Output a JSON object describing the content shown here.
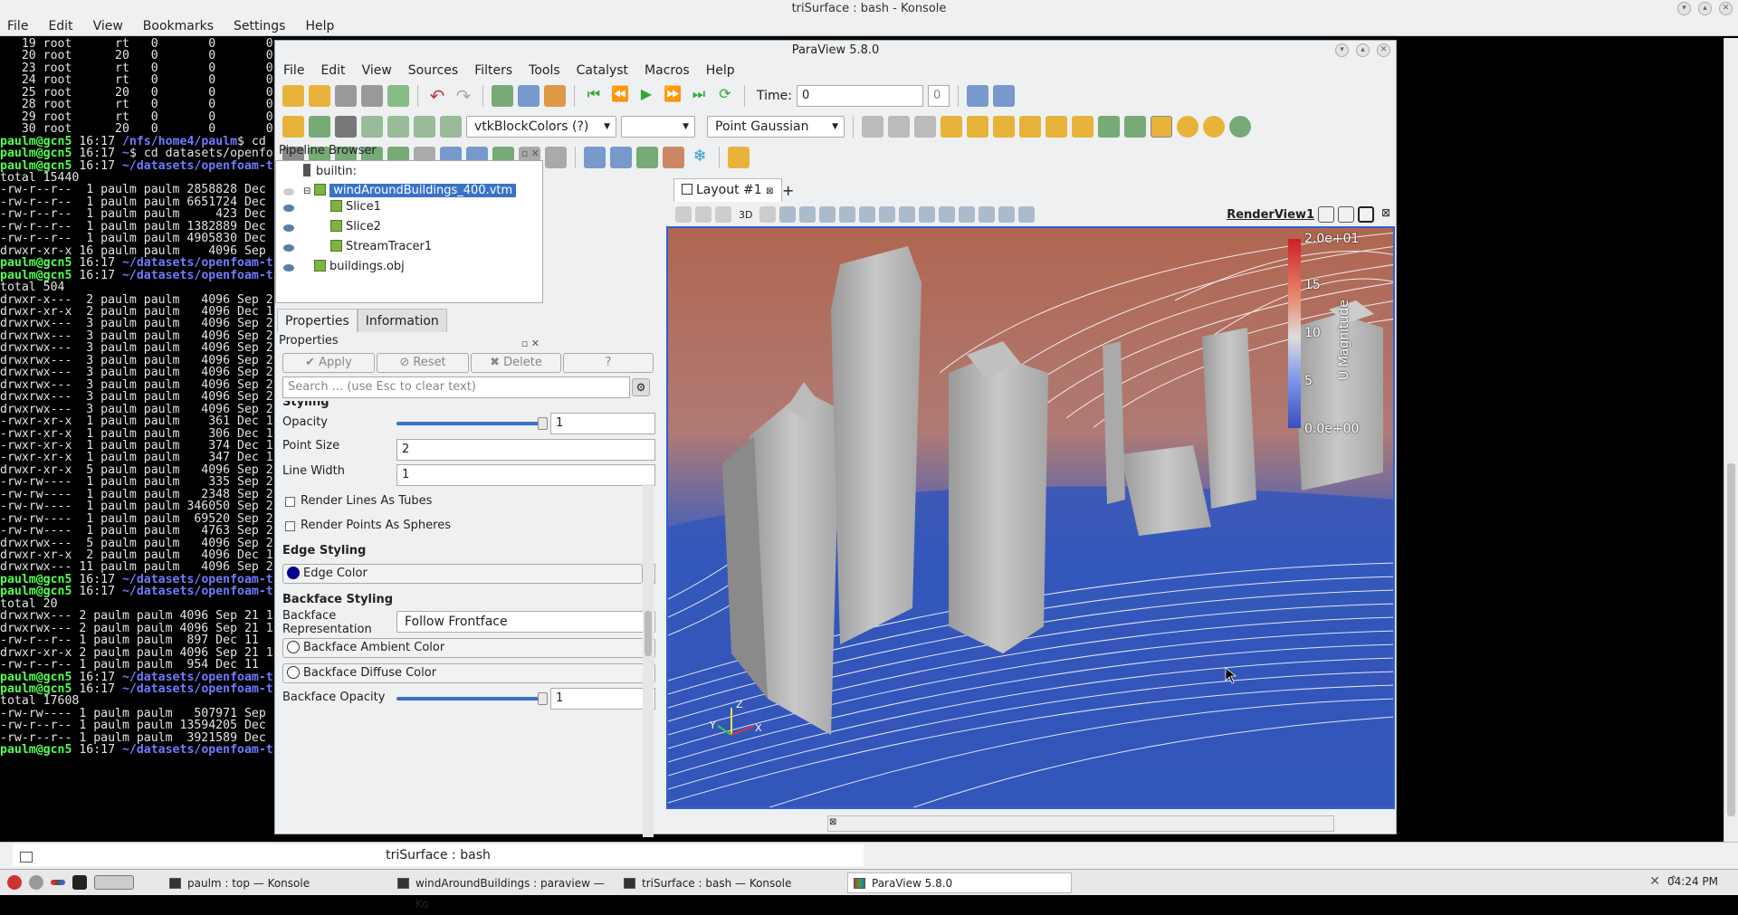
{
  "konsole": {
    "title": "triSurface : bash - Konsole",
    "menu": [
      "File",
      "Edit",
      "View",
      "Bookmarks",
      "Settings",
      "Help"
    ],
    "tab_title": "triSurface : bash",
    "lines": [
      {
        "t": "   19 root      rt   0       0       0"
      },
      {
        "t": "   20 root      20   0       0       0"
      },
      {
        "t": "   23 root      rt   0       0       0"
      },
      {
        "t": "   24 root      rt   0       0       0"
      },
      {
        "t": "   25 root      20   0       0       0"
      },
      {
        "t": "   28 root      rt   0       0       0"
      },
      {
        "t": "   29 root      rt   0       0       0"
      },
      {
        "t": "   30 root      20   0       0       0"
      },
      {
        "p": "paulm@gcn5",
        "m": " 16:17 ",
        "d": "/nfs/home4/paulm",
        "s": "$ cd"
      },
      {
        "p": "paulm@gcn5",
        "m": " 16:17 ",
        "d": "~",
        "s": "$ cd datasets/openfo"
      },
      {
        "p": "paulm@gcn5",
        "m": " 16:17 ",
        "d": "~/datasets/openfoam-t"
      },
      {
        "t": "total 15440"
      },
      {
        "t": "-rw-r--r--  1 paulm paulm 2858828 Dec"
      },
      {
        "t": "-rw-r--r--  1 paulm paulm 6651724 Dec"
      },
      {
        "t": "-rw-r--r--  1 paulm paulm     423 Dec"
      },
      {
        "t": "-rw-r--r--  1 paulm paulm 1382889 Dec"
      },
      {
        "t": "-rw-r--r--  1 paulm paulm 4905830 Dec"
      },
      {
        "t": "drwxr-xr-x 16 paulm paulm    4096 Sep"
      },
      {
        "p": "paulm@gcn5",
        "m": " 16:17 ",
        "d": "~/datasets/openfoam-t"
      },
      {
        "p": "paulm@gcn5",
        "m": " 16:17 ",
        "d": "~/datasets/openfoam-t"
      },
      {
        "t": "total 504"
      },
      {
        "t": "drwxr-x---  2 paulm paulm   4096 Sep 2"
      },
      {
        "t": "drwxr-xr-x  2 paulm paulm   4096 Dec 1"
      },
      {
        "t": "drwxrwx---  3 paulm paulm   4096 Sep 2"
      },
      {
        "t": "drwxrwx---  3 paulm paulm   4096 Sep 2"
      },
      {
        "t": "drwxrwx---  3 paulm paulm   4096 Sep 2"
      },
      {
        "t": "drwxrwx---  3 paulm paulm   4096 Sep 2"
      },
      {
        "t": "drwxrwx---  3 paulm paulm   4096 Sep 2"
      },
      {
        "t": "drwxrwx---  3 paulm paulm   4096 Sep 2"
      },
      {
        "t": "drwxrwx---  3 paulm paulm   4096 Sep 2"
      },
      {
        "t": "drwxrwx---  3 paulm paulm   4096 Sep 2"
      },
      {
        "t": "-rwxr-xr-x  1 paulm paulm    361 Dec 1"
      },
      {
        "t": "-rwxr-xr-x  1 paulm paulm    306 Dec 1"
      },
      {
        "t": "-rwxr-xr-x  1 paulm paulm    374 Dec 1"
      },
      {
        "t": "-rwxr-xr-x  1 paulm paulm    347 Dec 1"
      },
      {
        "t": "drwxr-xr-x  5 paulm paulm   4096 Sep 2"
      },
      {
        "t": "-rw-rw----  1 paulm paulm    335 Sep 2"
      },
      {
        "t": "-rw-rw----  1 paulm paulm   2348 Sep 2"
      },
      {
        "t": "-rw-rw----  1 paulm paulm 346050 Sep 2"
      },
      {
        "t": "-rw-rw----  1 paulm paulm  69520 Sep 2"
      },
      {
        "t": "-rw-rw----  1 paulm paulm   4763 Sep 2"
      },
      {
        "t": "drwxrwx---  5 paulm paulm   4096 Sep 2"
      },
      {
        "t": "drwxr-xr-x  2 paulm paulm   4096 Dec 1"
      },
      {
        "t": "drwxrwx--- 11 paulm paulm   4096 Sep 2"
      },
      {
        "p": "paulm@gcn5",
        "m": " 16:17 ",
        "d": "~/datasets/openfoam-t"
      },
      {
        "p": "paulm@gcn5",
        "m": " 16:17 ",
        "d": "~/datasets/openfoam-t"
      },
      {
        "t": "total 20"
      },
      {
        "t": "drwxrwx--- 2 paulm paulm 4096 Sep 21 1"
      },
      {
        "t": "drwxrwx--- 2 paulm paulm 4096 Sep 21 1"
      },
      {
        "t": "-rw-r--r-- 1 paulm paulm  897 Dec 11"
      },
      {
        "t": "drwxr-xr-x 2 paulm paulm 4096 Sep 21 1"
      },
      {
        "t": "-rw-r--r-- 1 paulm paulm  954 Dec 11"
      },
      {
        "p": "paulm@gcn5",
        "m": " 16:17 ",
        "d": "~/datasets/openfoam-t"
      },
      {
        "p": "paulm@gcn5",
        "m": " 16:17 ",
        "d": "~/datasets/openfoam-t"
      },
      {
        "t": "total 17608"
      },
      {
        "t": "-rw-rw---- 1 paulm paulm   507971 Sep"
      },
      {
        "t": "-rw-r--r-- 1 paulm paulm 13594205 Dec"
      },
      {
        "t": "-rw-r--r-- 1 paulm paulm  3921589 Dec"
      },
      {
        "p": "paulm@gcn5",
        "m": " 16:17 ",
        "d": "~/datasets/openfoam-t"
      }
    ]
  },
  "taskbar": {
    "tasks": [
      "paulm : top — Konsole",
      "windAroundBuildings : paraview — Ko",
      "triSurface : bash — Konsole",
      "ParaView 5.8.0"
    ],
    "clock": "04:24 PM"
  },
  "paraview": {
    "title": "ParaView 5.8.0",
    "menu": [
      "File",
      "Edit",
      "View",
      "Sources",
      "Filters",
      "Tools",
      "Catalyst",
      "Macros",
      "Help"
    ],
    "time_label": "Time:",
    "time_value": "0",
    "time_index": "0",
    "color_by": "vtkBlockColors (?)",
    "representation": "Point Gaussian",
    "pipeline": {
      "header": "Pipeline Browser",
      "items": [
        "builtin:",
        "windAroundBuildings_400.vtm",
        "Slice1",
        "Slice2",
        "StreamTracer1",
        "buildings.obj"
      ]
    },
    "tabs": {
      "properties": "Properties",
      "information": "Information"
    },
    "properties": {
      "header": "Properties",
      "apply": "Apply",
      "reset": "Reset",
      "delete": "Delete",
      "help": "?",
      "search_placeholder": "Search ... (use Esc to clear text)",
      "styling": "Styling",
      "opacity_label": "Opacity",
      "opacity_value": "1",
      "point_size_label": "Point Size",
      "point_size_value": "2",
      "line_width_label": "Line Width",
      "line_width_value": "1",
      "render_lines_tubes": "Render Lines As Tubes",
      "render_points_spheres": "Render Points As Spheres",
      "edge_styling": "Edge Styling",
      "edge_color": "Edge Color",
      "backface_styling": "Backface Styling",
      "backface_repr_label": "Backface Representation",
      "backface_repr_value": "Follow Frontface",
      "backface_ambient": "Backface Ambient Color",
      "backface_diffuse": "Backface Diffuse Color",
      "backface_opacity_label": "Backface Opacity",
      "backface_opacity_value": "1"
    },
    "layout_tab": "Layout #1",
    "render_view": "RenderView1",
    "view_3d": "3D",
    "colorbar": {
      "title": "U Magnitude",
      "labels": [
        "2.0e+01",
        "15",
        "10",
        "5",
        "0.0e+00"
      ]
    },
    "axes": {
      "x": "X",
      "y": "Y",
      "z": "Z"
    }
  }
}
